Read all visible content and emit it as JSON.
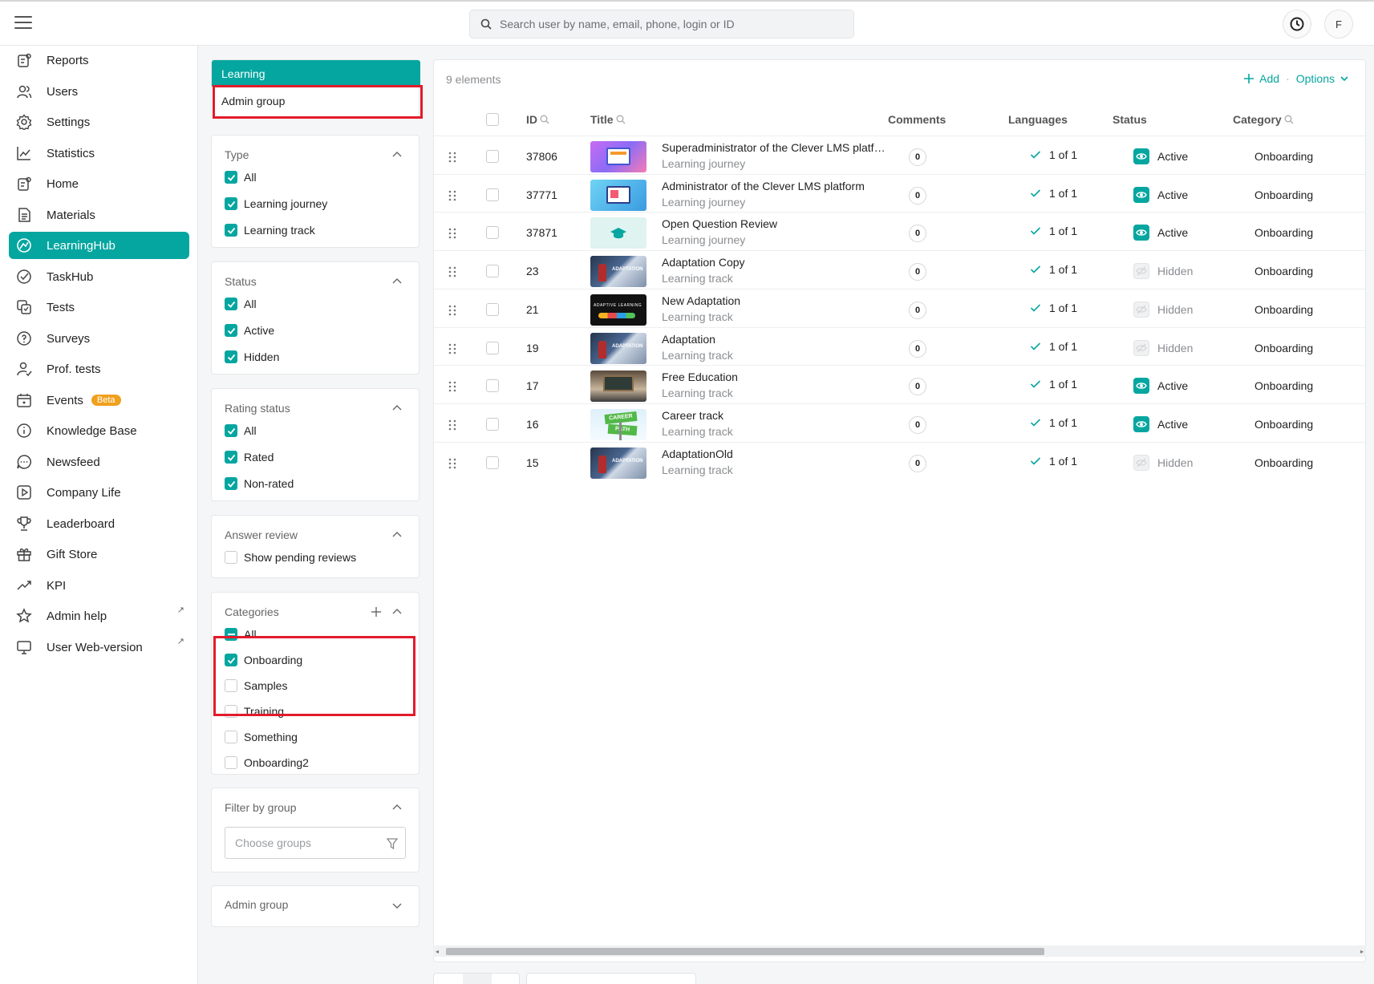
{
  "topbar": {
    "search_placeholder": "Search user by name, email, phone, login or ID",
    "avatar_letter": "F"
  },
  "sidebar": {
    "items": [
      {
        "label": "Reports",
        "icon": "reports-icon"
      },
      {
        "label": "Users",
        "icon": "users-icon"
      },
      {
        "label": "Settings",
        "icon": "gear-icon"
      },
      {
        "label": "Statistics",
        "icon": "statistics-icon"
      },
      {
        "label": "Home",
        "icon": "home-icon"
      },
      {
        "label": "Materials",
        "icon": "materials-icon"
      },
      {
        "label": "LearningHub",
        "icon": "learninghub-icon",
        "active": true
      },
      {
        "label": "TaskHub",
        "icon": "taskhub-icon"
      },
      {
        "label": "Tests",
        "icon": "tests-icon"
      },
      {
        "label": "Surveys",
        "icon": "surveys-icon"
      },
      {
        "label": "Prof. tests",
        "icon": "prof-tests-icon"
      },
      {
        "label": "Events",
        "icon": "calendar-icon",
        "badge": "Beta"
      },
      {
        "label": "Knowledge Base",
        "icon": "info-icon"
      },
      {
        "label": "Newsfeed",
        "icon": "chat-icon"
      },
      {
        "label": "Company Life",
        "icon": "play-icon"
      },
      {
        "label": "Leaderboard",
        "icon": "trophy-icon"
      },
      {
        "label": "Gift Store",
        "icon": "gift-icon"
      },
      {
        "label": "KPI",
        "icon": "trend-icon"
      },
      {
        "label": "Admin help",
        "icon": "star-icon",
        "external": true
      },
      {
        "label": "User Web-version",
        "icon": "monitor-icon",
        "external": true
      }
    ]
  },
  "section_tabs": {
    "learning": "Learning",
    "admin_group": "Admin group"
  },
  "filters": {
    "type": {
      "title": "Type",
      "options": [
        "All",
        "Learning journey",
        "Learning track"
      ]
    },
    "status": {
      "title": "Status",
      "options": [
        "All",
        "Active",
        "Hidden"
      ]
    },
    "rating": {
      "title": "Rating status",
      "options": [
        "All",
        "Rated",
        "Non-rated"
      ]
    },
    "answer_review": {
      "title": "Answer review",
      "options": [
        "Show pending reviews"
      ]
    },
    "categories": {
      "title": "Categories",
      "options": [
        "All",
        "Onboarding",
        "Samples",
        "Training",
        "Something",
        "Onboarding2"
      ]
    },
    "filter_by_group": {
      "title": "Filter by group",
      "placeholder": "Choose groups"
    },
    "admin_group": {
      "title": "Admin group"
    }
  },
  "main": {
    "count": "9 elements",
    "add_label": "Add",
    "options_label": "Options",
    "columns": [
      "ID",
      "Title",
      "Comments",
      "Languages",
      "Status",
      "Category"
    ],
    "rows": [
      {
        "id": "37806",
        "title": "Superadministrator of the Clever LMS platf…",
        "type": "Learning journey",
        "comments": "0",
        "lang": "1 of 1",
        "status": "Active",
        "category": "Onboarding"
      },
      {
        "id": "37771",
        "title": "Administrator of the Clever LMS platform",
        "type": "Learning journey",
        "comments": "0",
        "lang": "1 of 1",
        "status": "Active",
        "category": "Onboarding"
      },
      {
        "id": "37871",
        "title": "Open Question Review",
        "type": "Learning journey",
        "comments": "0",
        "lang": "1 of 1",
        "status": "Active",
        "category": "Onboarding"
      },
      {
        "id": "23",
        "title": "Adaptation Copy",
        "type": "Learning track",
        "comments": "0",
        "lang": "1 of 1",
        "status": "Hidden",
        "category": "Onboarding"
      },
      {
        "id": "21",
        "title": "New Adaptation",
        "type": "Learning track",
        "comments": "0",
        "lang": "1 of 1",
        "status": "Hidden",
        "category": "Onboarding"
      },
      {
        "id": "19",
        "title": "Adaptation",
        "type": "Learning track",
        "comments": "0",
        "lang": "1 of 1",
        "status": "Hidden",
        "category": "Onboarding"
      },
      {
        "id": "17",
        "title": "Free Education",
        "type": "Learning track",
        "comments": "0",
        "lang": "1 of 1",
        "status": "Active",
        "category": "Onboarding"
      },
      {
        "id": "16",
        "title": "Career track",
        "type": "Learning track",
        "comments": "0",
        "lang": "1 of 1",
        "status": "Active",
        "category": "Onboarding"
      },
      {
        "id": "15",
        "title": "AdaptationOld",
        "type": "Learning track",
        "comments": "0",
        "lang": "1 of 1",
        "status": "Hidden",
        "category": "Onboarding"
      }
    ],
    "thumb_text": {
      "adaptation": "ADAPTATION",
      "adaptive": "ADAPTIVE LEARNING",
      "career": "CAREER",
      "path": "PATH"
    }
  },
  "colors": {
    "accent": "#05a6a0",
    "highlight": "#e21b2b",
    "beta": "#f0a01c"
  }
}
